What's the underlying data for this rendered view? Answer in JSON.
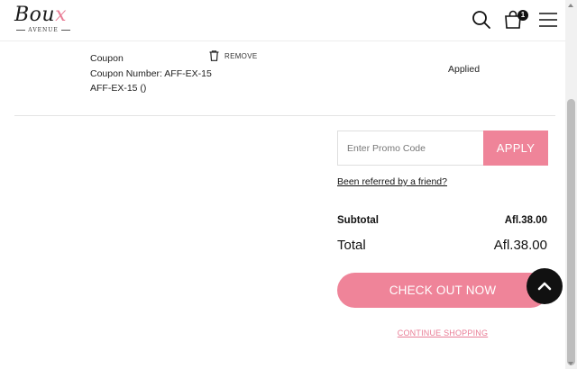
{
  "header": {
    "logo_text": "Bou",
    "logo_accent": "x",
    "logo_sub": "AVENUE",
    "cart_count": "1",
    "icons": [
      "search-icon",
      "shopping-bag-icon",
      "hamburger-menu-icon"
    ]
  },
  "coupon": {
    "title": "Coupon",
    "number_line": "Coupon Number: AFF-EX-15",
    "code_line": "AFF-EX-15 ()",
    "remove_label": "REMOVE",
    "status": "Applied"
  },
  "promo": {
    "placeholder": "Enter Promo Code",
    "apply_label": "APPLY",
    "referred_link": "Been referred by a friend?"
  },
  "totals": {
    "subtotal_label": "Subtotal",
    "subtotal_value": "Afl.38.00",
    "total_label": "Total",
    "total_value": "Afl.38.00"
  },
  "actions": {
    "checkout_label": "CHECK OUT NOW",
    "continue_label": "CONTINUE SHOPPING"
  },
  "colors": {
    "accent_pink": "#ef8499",
    "text_dark": "#111111",
    "fab_bg": "#111111"
  }
}
